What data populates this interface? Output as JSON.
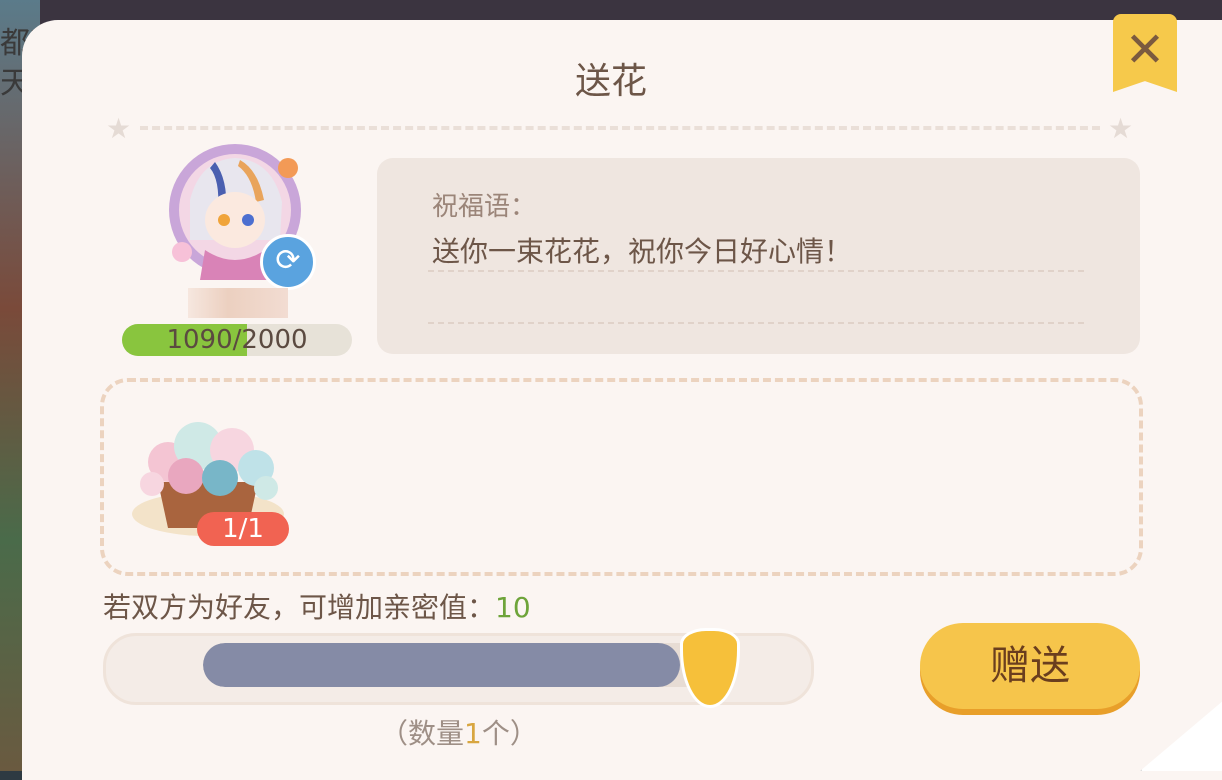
{
  "background": {
    "text_line1": "都萝",
    "text_line2": "天"
  },
  "dialog": {
    "title": "送花",
    "close_icon": "close-x-icon",
    "recipient": {
      "progress_current": 1090,
      "progress_max": 2000,
      "progress_text": "1090/2000",
      "refresh_icon": "refresh-icon"
    },
    "wish": {
      "label": "祝福语：",
      "message": "送你一束花花，祝你今日好心情！"
    },
    "item": {
      "count_text": "1/1",
      "icon": "flower-basket-icon"
    },
    "hint": {
      "text": "若双方为好友，可增加亲密值：",
      "value": "10"
    },
    "slider": {
      "fraction": 0.9
    },
    "send_label": "赠送",
    "quantity": {
      "prefix": "（数量",
      "number": "1",
      "suffix": "个）"
    }
  },
  "colors": {
    "accent": "#f6c54b",
    "progress_fill": "#89c53e",
    "badge": "#f16352",
    "hint_value": "#6ea43a"
  }
}
